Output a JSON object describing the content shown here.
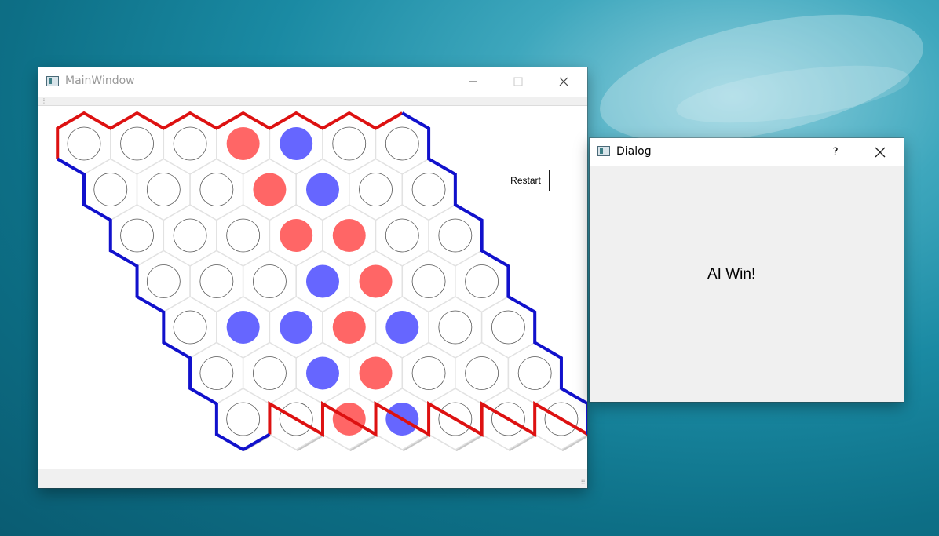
{
  "desktop": {
    "wallpaper": "ocean water"
  },
  "main_window": {
    "title": "MainWindow",
    "icon": "app-window-icon",
    "controls": [
      "minimize-icon",
      "maximize-icon",
      "close-icon"
    ],
    "restart_label": "Restart"
  },
  "dialog": {
    "title": "Dialog",
    "icon": "app-window-icon",
    "help_label": "?",
    "controls": [
      "help-icon",
      "close-icon"
    ],
    "message": "AI Win!"
  },
  "board": {
    "size": 7,
    "colors": {
      "red_stone": "#ff6666",
      "blue_stone": "#6666ff",
      "red_edge": "#dd1111",
      "blue_edge": "#1111cc",
      "empty_outline": "#555555",
      "cell_fill": "#ffffff",
      "cell_shadow": "#c8c8c8"
    },
    "edges": {
      "top_bottom": "red",
      "left_right": "blue"
    },
    "cells": [
      [
        "empty",
        "empty",
        "empty",
        "red",
        "blue",
        "empty",
        "empty"
      ],
      [
        "empty",
        "empty",
        "empty",
        "red",
        "blue",
        "empty",
        "empty"
      ],
      [
        "empty",
        "empty",
        "empty",
        "red",
        "red",
        "empty",
        "empty"
      ],
      [
        "empty",
        "empty",
        "empty",
        "blue",
        "red",
        "empty",
        "empty"
      ],
      [
        "empty",
        "blue",
        "blue",
        "red",
        "blue",
        "empty",
        "empty"
      ],
      [
        "empty",
        "empty",
        "blue",
        "red",
        "empty",
        "empty",
        "empty"
      ],
      [
        "empty",
        "empty",
        "red",
        "blue",
        "empty",
        "empty",
        "empty"
      ]
    ]
  }
}
